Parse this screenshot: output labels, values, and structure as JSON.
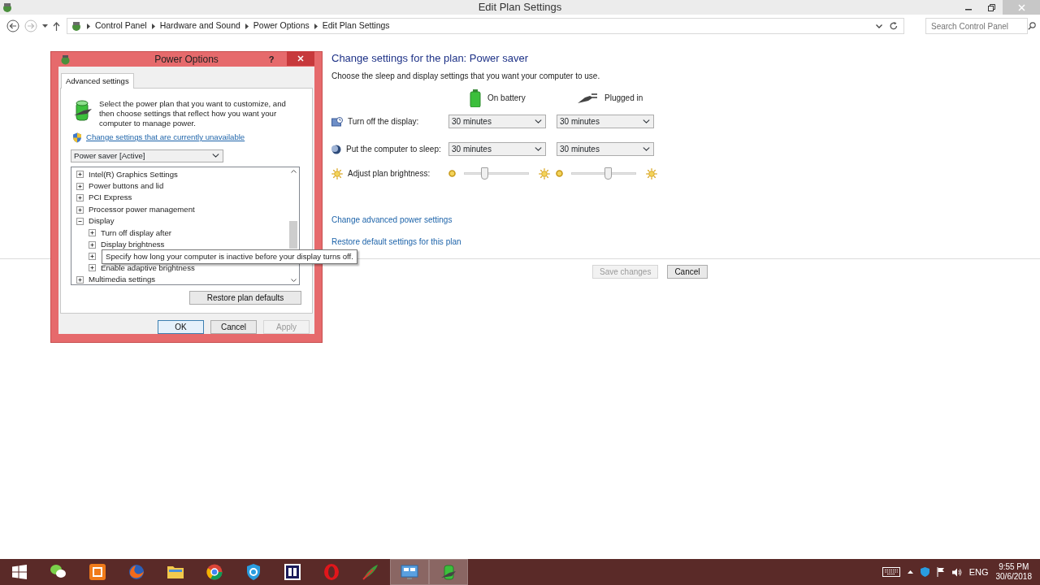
{
  "window": {
    "title": "Edit Plan Settings"
  },
  "address_bar": {
    "breadcrumb": [
      "Control Panel",
      "Hardware and Sound",
      "Power Options",
      "Edit Plan Settings"
    ],
    "search_placeholder": "Search Control Panel"
  },
  "plan": {
    "heading": "Change settings for the plan: Power saver",
    "description": "Choose the sleep and display settings that you want your computer to use.",
    "columns": [
      {
        "label": "On battery"
      },
      {
        "label": "Plugged in"
      }
    ],
    "settings": [
      {
        "kind": "dropdown",
        "label": "Turn off the display:",
        "values": [
          "30 minutes",
          "30 minutes"
        ]
      },
      {
        "kind": "dropdown",
        "label": "Put the computer to sleep:",
        "values": [
          "30 minutes",
          "30 minutes"
        ]
      },
      {
        "kind": "slider",
        "label": "Adjust plan brightness:",
        "sliders": [
          {
            "level": 0.31
          },
          {
            "level": 0.57
          }
        ]
      }
    ],
    "links": [
      "Change advanced power settings",
      "Restore default settings for this plan"
    ],
    "buttons": [
      {
        "label": "Save changes",
        "disabled": true
      },
      {
        "label": "Cancel",
        "disabled": false
      }
    ]
  },
  "dialog": {
    "title": "Power Options",
    "help_label": "?",
    "tabs": [
      {
        "label": "Advanced settings",
        "selected": true
      }
    ],
    "intro": "Select the power plan that you want to customize, and then choose settings that reflect how you want your computer to manage power.",
    "admin_link": "Change settings that are currently unavailable",
    "plan_select": "Power saver [Active]",
    "tree": [
      {
        "label": "Intel(R) Graphics Settings",
        "expanded": false
      },
      {
        "label": "Power buttons and lid",
        "expanded": false
      },
      {
        "label": "PCI Express",
        "expanded": false
      },
      {
        "label": "Processor power management",
        "expanded": false
      },
      {
        "label": "Display",
        "expanded": true,
        "children": [
          {
            "label": "Turn off display after",
            "expanded": false
          },
          {
            "label": "Display brightness",
            "expanded": false
          },
          {
            "expanded": false
          },
          {
            "label": "Enable adaptive brightness",
            "expanded": false
          }
        ]
      },
      {
        "label": "Multimedia settings",
        "expanded": false
      }
    ],
    "tooltip": "Specify how long your computer is inactive before your display turns off.",
    "restore_button": "Restore plan defaults",
    "buttons": [
      {
        "label": "OK",
        "disabled": false,
        "default": true
      },
      {
        "label": "Cancel",
        "disabled": false,
        "default": false
      },
      {
        "label": "Apply",
        "disabled": true,
        "default": false
      }
    ]
  },
  "taskbar": {
    "apps": [
      {
        "selected": false
      },
      {
        "selected": false
      },
      {
        "selected": false
      },
      {
        "selected": false
      },
      {
        "selected": false
      },
      {
        "selected": false
      },
      {
        "selected": false
      },
      {
        "selected": false
      },
      {
        "selected": false
      },
      {
        "selected": true
      },
      {
        "selected": true
      }
    ],
    "language": "ENG",
    "time": "9:55 PM",
    "date": "30/6/2018"
  }
}
